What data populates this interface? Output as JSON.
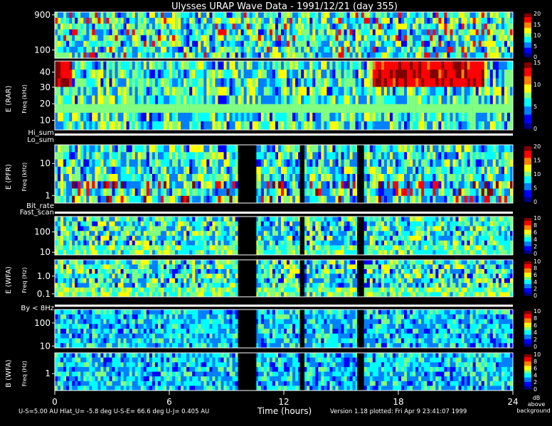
{
  "chart_data": {
    "type": "heatmap",
    "title": "Ulysses URAP Wave Data - 1991/12/21  (day 355)",
    "x": {
      "label": "Time (hours)",
      "range": [
        0,
        24
      ],
      "ticks": [
        0,
        6,
        12,
        18,
        24
      ]
    },
    "panels": [
      {
        "id": "rar-upper",
        "ylabel": "",
        "y_ticks": [
          "900",
          "100"
        ],
        "scale_max": 20,
        "scale_ticks": [
          "20",
          "15",
          "10",
          "5",
          "0"
        ]
      },
      {
        "id": "rar-lower",
        "ylabel": "E (RAR)",
        "ylabel_sub": "Freq (kHz)",
        "y_ticks": [
          "40",
          "30",
          "20",
          "10"
        ],
        "scale_max": 15,
        "scale_ticks": [
          "15",
          "10",
          "5",
          "0"
        ]
      },
      {
        "id": "pfr",
        "ylabel": "E (PFR)",
        "ylabel_sub": "Freq (kHz)",
        "y_ticks": [
          "10",
          "1"
        ],
        "scale_max": 20,
        "scale_ticks": [
          "20",
          "15",
          "10",
          "5",
          "0"
        ]
      },
      {
        "id": "wfa-e-high",
        "ylabel": "",
        "y_ticks": [
          "100",
          "10"
        ],
        "scale_max": 10,
        "scale_ticks": [
          "10",
          "8",
          "6",
          "4",
          "2",
          "0"
        ]
      },
      {
        "id": "wfa-e-low",
        "ylabel": "E (WFA)",
        "ylabel_sub": "Freq (Hz)",
        "y_ticks": [
          "1.0",
          "0.1"
        ],
        "scale_max": 10,
        "scale_ticks": [
          "10",
          "8",
          "6",
          "4",
          "2",
          "0"
        ]
      },
      {
        "id": "wfa-b-high",
        "ylabel": "",
        "y_ticks": [
          "100",
          "10"
        ],
        "scale_max": 10,
        "scale_ticks": [
          "10",
          "8",
          "6",
          "4",
          "2",
          "0"
        ]
      },
      {
        "id": "wfa-b-low",
        "ylabel": "B (WFA)",
        "ylabel_sub": "Freq (Hz)",
        "y_ticks": [
          "1"
        ],
        "scale_max": 10,
        "scale_ticks": [
          "10",
          "8",
          "6",
          "4",
          "2",
          "0"
        ]
      }
    ],
    "status_bars": [
      {
        "id": "hi-lo-sum",
        "labels": [
          "Hi_sum",
          "Lo_sum"
        ]
      },
      {
        "id": "bitrate-fastscan",
        "labels": [
          "Bit_rate",
          "Fast_scan"
        ]
      },
      {
        "id": "by-8hz",
        "labels": [
          "By < 8Hz"
        ]
      }
    ],
    "colorbar_unit": [
      "dB",
      "above",
      "background"
    ],
    "colormap": [
      "#00008f",
      "#0000ff",
      "#0080ff",
      "#00ffff",
      "#80ff80",
      "#ffff00",
      "#ff8000",
      "#ff0000",
      "#800000"
    ]
  },
  "footer": {
    "left": "U-S=5.00 AU  Hlat_U= -5.8 deg  U-S-E= 66.6 deg  U-J= 0.405 AU",
    "right": "Version 1.18 plotted: Fri Apr  9 23:41:07 1999"
  }
}
